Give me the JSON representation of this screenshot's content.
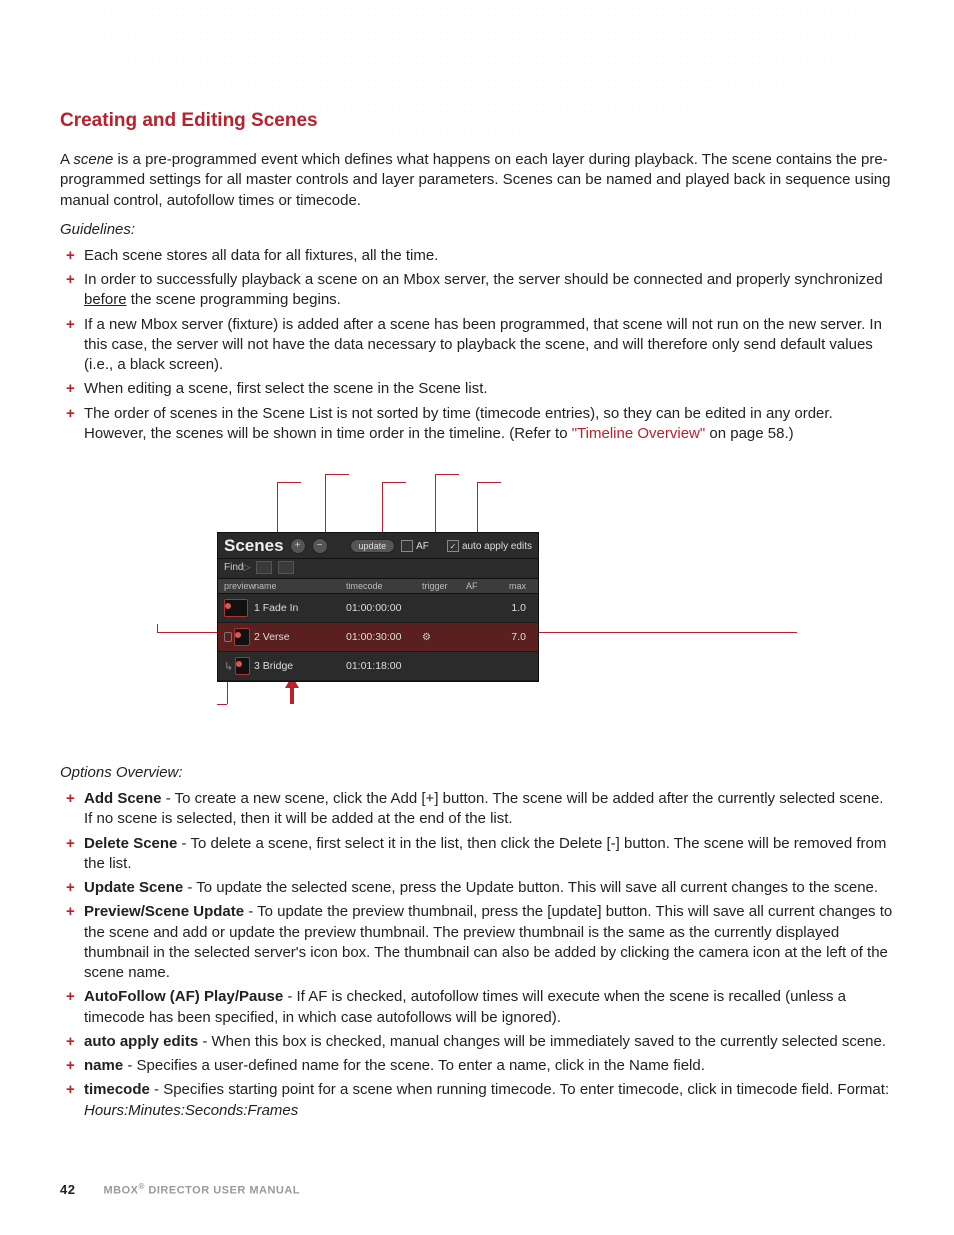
{
  "heading": "Creating and Editing Scenes",
  "intro": "A scene is a pre-programmed event which defines what happens on each layer during playback. The scene contains the pre-programmed settings for all master controls and layer parameters. Scenes can be named and played back in sequence using manual control, autofollow times or timecode.",
  "intro_em": "scene",
  "guidelines_label": "Guidelines:",
  "guidelines": [
    "Each scene stores all data for all fixtures, all the time.",
    "In order to successfully playback a scene on an Mbox server, the server should be connected and properly synchronized before the scene programming begins.",
    "If a new Mbox server (fixture) is added after a scene has been programmed, that scene will not run on the new server. In this case, the server will not have the data necessary to playback the scene, and will therefore only send default values (i.e., a black screen).",
    "When editing a scene, first select the scene in the Scene list.",
    "The order of scenes in the Scene List is not sorted by time (timecode entries), so they can be edited in any order. However, the scenes will be shown in time order in the timeline. (Refer to \"Timeline Overview\" on page 58.)"
  ],
  "xref_text": "\"Timeline Overview\"",
  "xref_page": "on page 58.)",
  "options_label": "Options Overview:",
  "options": [
    {
      "term": "Add Scene",
      "desc": " - To create a new scene, click the Add [+] button. The scene will be added after the currently selected scene. If no scene is selected, then it will be added at the end of the list."
    },
    {
      "term": "Delete Scene",
      "desc": " - To delete a scene, first select it in the list, then click the Delete [-] button. The scene will be removed from the list."
    },
    {
      "term": "Update Scene",
      "desc": " - To update the selected scene, press the Update button. This will save all current changes to the scene."
    },
    {
      "term": "Preview/Scene Update",
      "desc": " - To update the preview thumbnail, press the [update] button. This will save all current changes to the scene and add or update the preview thumbnail. The preview thumbnail is the same as the currently displayed thumbnail in the selected server's icon box. The thumbnail can also be added by clicking the camera icon at the left of the scene name."
    },
    {
      "term": "AutoFollow (AF) Play/Pause",
      "desc": " - If AF is checked, autofollow times will execute when the scene is recalled (unless a timecode has been specified, in which case autofollows will be ignored)."
    },
    {
      "term": "auto apply edits",
      "desc": " - When this box is checked, manual changes will be immediately saved to the currently selected scene."
    },
    {
      "term": "name",
      "desc": " - Specifies a user-defined name for the scene. To enter a name, click in the Name field."
    },
    {
      "term": "timecode",
      "desc": " - Specifies starting point for a scene when running timecode. To enter timecode, click in timecode field. Format: Hours:Minutes:Seconds:Frames"
    }
  ],
  "timecode_format_em": "Hours:Minutes:Seconds:Frames",
  "panel": {
    "title": "Scenes",
    "add_icon": "+",
    "del_icon": "−",
    "update_label": "update",
    "af_label": "AF",
    "af_checked": false,
    "auto_apply_label": "auto apply edits",
    "auto_apply_checked": true,
    "find_label": "Find",
    "cols": {
      "preview": "preview",
      "name": "name",
      "timecode": "timecode",
      "trigger": "trigger",
      "af": "AF",
      "max": "max"
    },
    "rows": [
      {
        "idx": "1",
        "name": "Fade In",
        "tc": "01:00:00:00",
        "trigger": "",
        "max": "1.0",
        "selected": false,
        "link": false
      },
      {
        "idx": "2",
        "name": "Verse",
        "tc": "01:00:30:00",
        "trigger": "⚙",
        "max": "7.0",
        "selected": true,
        "link": false
      },
      {
        "idx": "3",
        "name": "Bridge",
        "tc": "01:01:18:00",
        "trigger": "",
        "max": "",
        "selected": false,
        "link": true
      }
    ]
  },
  "footer": {
    "page": "42",
    "title": "MBOX® DIRECTOR USER MANUAL"
  }
}
